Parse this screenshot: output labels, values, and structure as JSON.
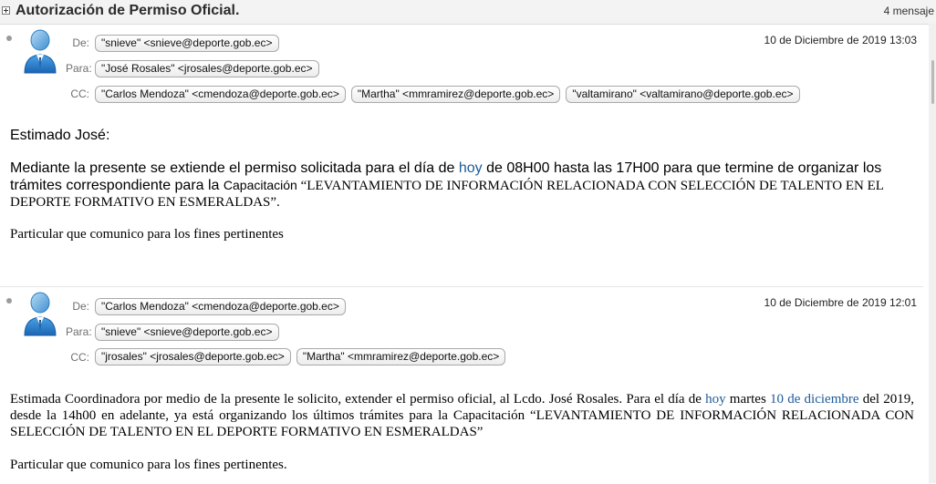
{
  "thread": {
    "title": "Autorización de Permiso Oficial.",
    "count_label": "4 mensaje"
  },
  "labels": {
    "from": "De:",
    "to": "Para:",
    "cc": "CC:"
  },
  "messages": [
    {
      "from": "\"snieve\" <snieve@deporte.gob.ec>",
      "to": "\"José Rosales\" <jrosales@deporte.gob.ec>",
      "cc": [
        "\"Carlos Mendoza\" <cmendoza@deporte.gob.ec>",
        "\"Martha\" <mmramirez@deporte.gob.ec>",
        "\"valtamirano\" <valtamirano@deporte.gob.ec>"
      ],
      "date": "10 de Diciembre de 2019 13:03",
      "greeting": "Estimado José:",
      "body_pre": "Mediante la presente se extiende el permiso solicitada para el día de ",
      "body_link": "hoy",
      "body_mid": " de 08H00 hasta las 17H00 para que termine de organizar los trámites correspondiente para la ",
      "body_cap": "Capacitación",
      "body_post": " “LEVANTAMIENTO DE INFORMACIÓN RELACIONADA CON SELECCIÓN DE TALENTO EN EL DEPORTE FORMATIVO EN ESMERALDAS”.",
      "closing": "Particular que comunico para los fines pertinentes"
    },
    {
      "from": "\"Carlos Mendoza\" <cmendoza@deporte.gob.ec>",
      "to": "\"snieve\" <snieve@deporte.gob.ec>",
      "cc": [
        "\"jrosales\" <jrosales@deporte.gob.ec>",
        "\"Martha\" <mmramirez@deporte.gob.ec>"
      ],
      "date": "10 de Diciembre de 2019 12:01",
      "body_pre": "Estimada Coordinadora por medio de la presente le solicito, extender el permiso oficial, al Lcdo. José Rosales. Para el día de ",
      "body_link1": "hoy",
      "body_mid": " martes ",
      "body_link2": "10 de diciembre",
      "body_post": " del 2019, desde la 14h00 en adelante, ya está organizando los últimos trámites para la Capacitación “LEVANTAMIENTO DE INFORMACIÓN RELACIONADA CON SELECCIÓN DE TALENTO EN EL DEPORTE FORMATIVO EN ESMERALDAS”",
      "closing": "Particular que comunico para los fines pertinentes."
    }
  ]
}
